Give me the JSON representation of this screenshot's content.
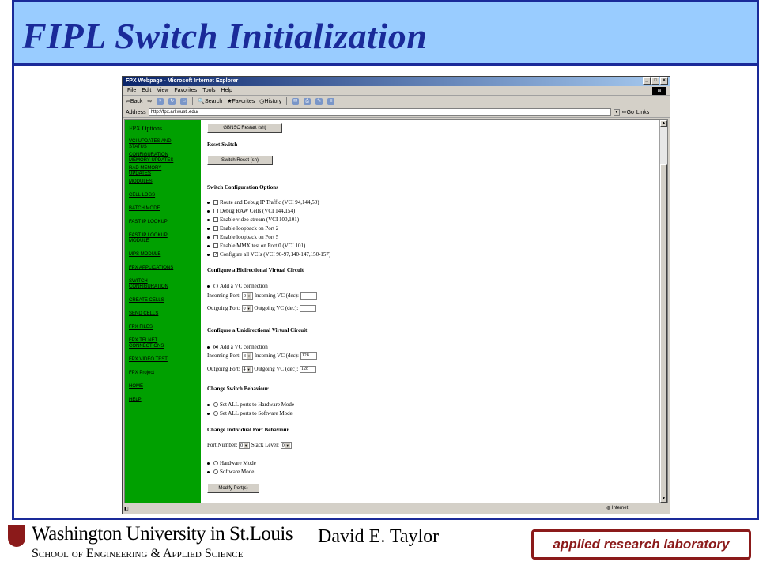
{
  "slide": {
    "title": "FIPL Switch Initialization",
    "author": "David E. Taylor",
    "university_name": "Washington University in St.Louis",
    "school_name": "School of Engineering & Applied Science",
    "lab_badge": "applied research laboratory",
    "colors": {
      "title_band": "#99ccff",
      "title_text": "#1a2a99",
      "badge": "#8b1a1a"
    }
  },
  "browser": {
    "window_title": "FPX Webpage - Microsoft Internet Explorer",
    "menu": [
      "File",
      "Edit",
      "View",
      "Favorites",
      "Tools",
      "Help"
    ],
    "toolbar": {
      "back": "Back",
      "search": "Search",
      "favorites": "Favorites",
      "history": "History"
    },
    "address_label": "Address",
    "address_value": "http://fpx.arl.wustl.edu/",
    "go_label": "Go",
    "links_label": "Links",
    "status_zone": "Internet"
  },
  "sidebar": {
    "title": "FPX Options",
    "color": "#00a000",
    "links": [
      "VCI UPDATES AND STATUS",
      "CONFIGURATION MEMORY UPDATES",
      "RAD MEMORY UPDATES",
      "MODULES",
      "CELL LOGS",
      "BATCH MODE",
      "FAST IP LOOKUP",
      "FAST IP LOOKUP Module",
      "MPS MODULE",
      "FPX APPLICATIONS",
      "SWITCH CONFIGURATION",
      "CREATE CELLS",
      "SEND CELLS",
      "FPX FILES",
      "FPX TELNET CONNECTIONS",
      "FPX VIDEO TEST",
      "FPX Project",
      "HOME",
      "HELP"
    ]
  },
  "main": {
    "gbnsc_button": "GBNSC Restart (sh)",
    "reset_heading": "Reset Switch",
    "reset_button": "Switch Reset (sh)",
    "config_heading": "Switch Configuration Options",
    "config_options": [
      {
        "label": "Route and Debug IP Traffic (VCI 94,144,50)",
        "checked": false
      },
      {
        "label": "Debug RAW Cells (VCI 144,154)",
        "checked": false
      },
      {
        "label": "Enable video stream (VCI 100,101)",
        "checked": false
      },
      {
        "label": "Enable loopback on Port 2",
        "checked": false
      },
      {
        "label": "Enable loopback on Port 5",
        "checked": false
      },
      {
        "label": "Enable MMX test on Port 0 (VCI 101)",
        "checked": false
      },
      {
        "label": "Configure all VCIs (VCI 90-97,140-147,150-157)",
        "checked": true
      }
    ],
    "bidir": {
      "heading": "Configure a Bidirectional Virtual Circuit",
      "add_label": "Add a VC connection",
      "incoming_port_label": "Incoming Port:",
      "incoming_port_value": "0",
      "incoming_vc_label": "Incoming VC (dec):",
      "incoming_vc_value": "",
      "outgoing_port_label": "Outgoing Port:",
      "outgoing_port_value": "0",
      "outgoing_vc_label": "Outgoing VC (dec):",
      "outgoing_vc_value": ""
    },
    "unidir": {
      "heading": "Configure a Unidirectional Virtual Circuit",
      "add_label": "Add a VC connection",
      "incoming_port_label": "Incoming Port:",
      "incoming_port_value": "3",
      "incoming_vc_label": "Incoming VC (dec):",
      "incoming_vc_value": "128",
      "outgoing_port_label": "Outgoing Port:",
      "outgoing_port_value": "4",
      "outgoing_vc_label": "Outgoing VC (dec):",
      "outgoing_vc_value": "128"
    },
    "behaviour": {
      "heading": "Change Switch Behaviour",
      "opt_hw": "Set ALL ports to Hardware Mode",
      "opt_sw": "Set ALL ports to Software Mode"
    },
    "port_behaviour": {
      "heading": "Change Individual Port Behaviour",
      "port_number_label": "Port Number:",
      "port_number_value": "0",
      "stack_level_label": "Stack Level:",
      "stack_level_value": "0",
      "opt_hw": "Hardware Mode",
      "opt_sw": "Software Mode",
      "modify_button": "Modify Port(s)"
    }
  }
}
